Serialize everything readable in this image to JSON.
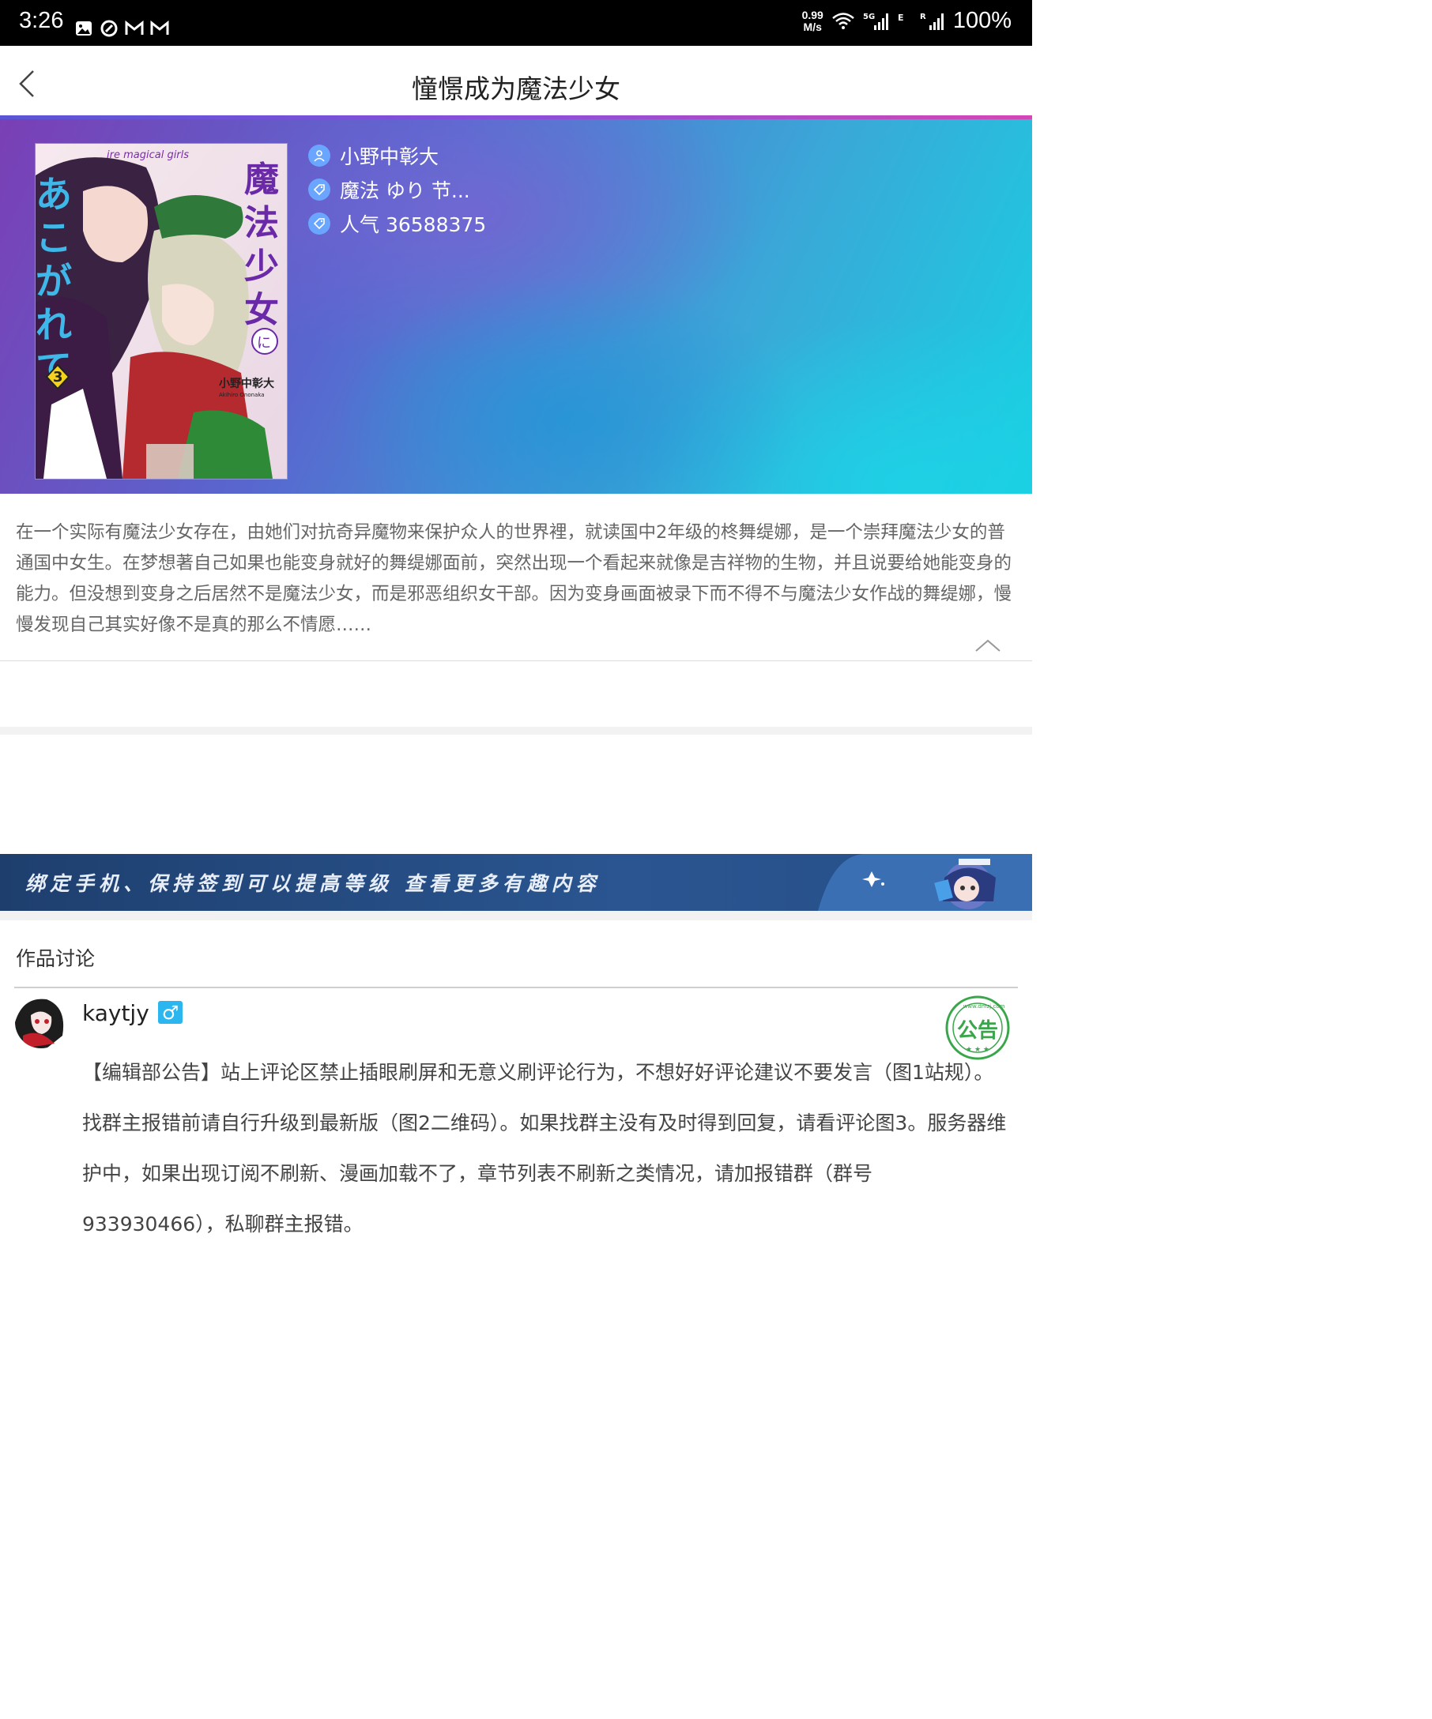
{
  "status_bar": {
    "time": "3:26",
    "speed_value": "0.99",
    "speed_unit": "M/s",
    "battery": "100%",
    "icons": [
      "gallery-icon",
      "sync-icon",
      "gmail-icon",
      "gmail-icon",
      "wifi-icon",
      "signal-5g-icon",
      "signal-r-icon"
    ]
  },
  "header": {
    "title": "憧憬成为魔法少女"
  },
  "book": {
    "author": "小野中彰大",
    "tags": "魔法 ゆり 节...",
    "popularity": "人气 36588375",
    "cover_title_jp": "魔法少女にあこがれて",
    "cover_subtitle": "ire magical girls",
    "cover_volume": "3",
    "cover_author": "小野中彰大",
    "cover_author_romaji": "Akihiro Ononaka"
  },
  "description": "在一个实际有魔法少女存在，由她们对抗奇异魔物来保护众人的世界裡，就读国中2年级的柊舞缇娜，是一个崇拜魔法少女的普通国中女生。在梦想著自己如果也能变身就好的舞缇娜面前，突然出现一个看起来就像是吉祥物的生物，并且说要给她能变身的能力。但没想到变身之后居然不是魔法少女，而是邪恶组织女干部。因为变身画面被录下而不得不与魔法少女作战的舞缇娜，慢慢发现自己其实好像不是真的那么不情愿……",
  "banner": {
    "text": "绑定手机、保持签到可以提高等级 查看更多有趣内容"
  },
  "discussion": {
    "title": "作品讨论",
    "comments": [
      {
        "username": "kaytjy",
        "gender_symbol": "♂",
        "stamp_text": "公告",
        "stamp_url": "www.dmzj.com",
        "text": "【编辑部公告】站上评论区禁止插眼刷屏和无意义刷评论行为，不想好好评论建议不要发言（图1站规）。找群主报错前请自行升级到最新版（图2二维码）。如果找群主没有及时得到回复，请看评论图3。服务器维护中，如果出现订阅不刷新、漫画加载不了，章节列表不刷新之类情况，请加报错群（群号933930466），私聊群主报错。"
      }
    ]
  },
  "colors": {
    "accent_blue": "#2cb6f0",
    "hero_purple": "#7a3fb5",
    "hero_cyan": "#18d0e2",
    "stamp_green": "#3aa64a"
  }
}
